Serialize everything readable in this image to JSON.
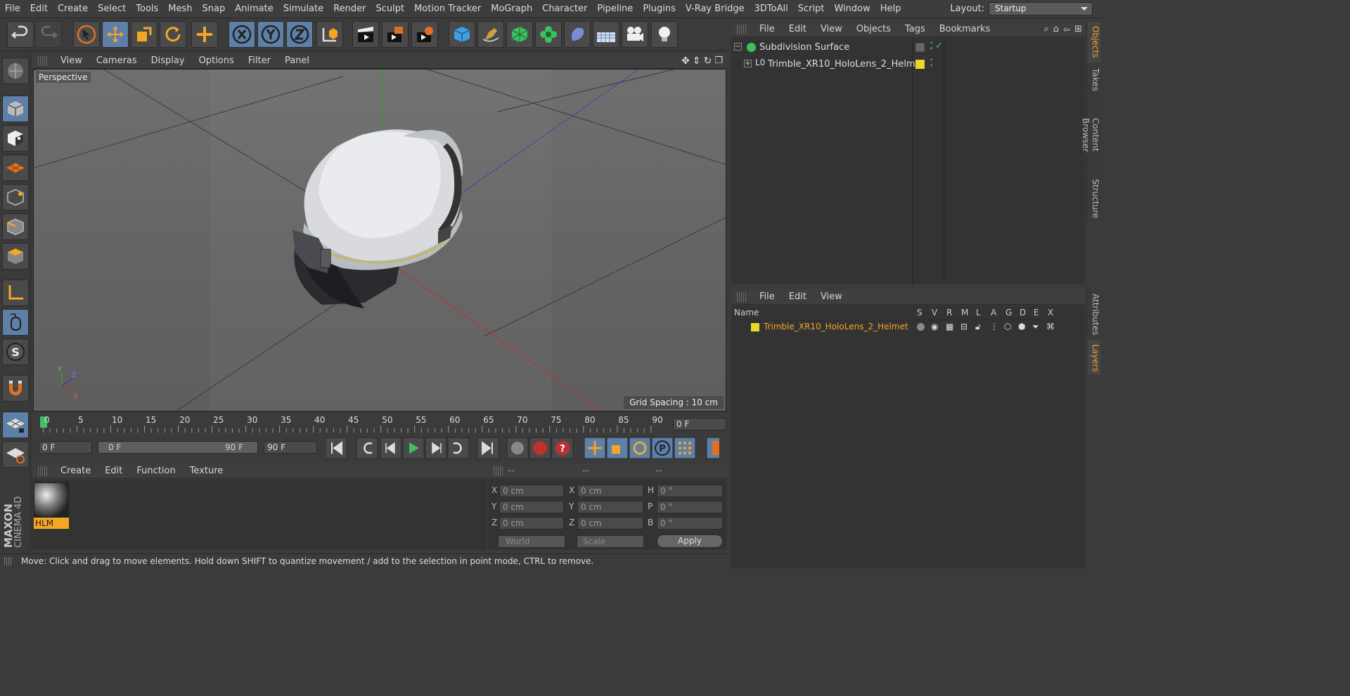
{
  "menubar": {
    "items": [
      "File",
      "Edit",
      "Create",
      "Select",
      "Tools",
      "Mesh",
      "Snap",
      "Animate",
      "Simulate",
      "Render",
      "Sculpt",
      "Motion Tracker",
      "MoGraph",
      "Character",
      "Pipeline",
      "Plugins",
      "V-Ray Bridge",
      "3DToAll",
      "Script",
      "Window",
      "Help"
    ],
    "layout_label": "Layout:",
    "layout_value": "Startup"
  },
  "viewport": {
    "menu": [
      "View",
      "Cameras",
      "Display",
      "Options",
      "Filter",
      "Panel"
    ],
    "camera_label": "Perspective",
    "grid_spacing": "Grid Spacing : 10 cm",
    "axis": {
      "y": "Y",
      "z": "Z",
      "x": "X"
    }
  },
  "timeline": {
    "ticks": [
      "0",
      "5",
      "10",
      "15",
      "20",
      "25",
      "30",
      "35",
      "40",
      "45",
      "50",
      "55",
      "60",
      "65",
      "70",
      "75",
      "80",
      "85",
      "90"
    ],
    "current_frame": "0 F",
    "start_frame": "0 F",
    "range_start": "0 F",
    "range_end": "90 F",
    "end_frame": "90 F"
  },
  "objects_panel": {
    "menu": [
      "File",
      "Edit",
      "View",
      "Objects",
      "Tags",
      "Bookmarks"
    ],
    "items": [
      {
        "name": "Subdivision Surface"
      },
      {
        "name": "Trimble_XR10_HoloLens_2_Helmet"
      }
    ]
  },
  "layers_panel": {
    "menu": [
      "File",
      "Edit",
      "View"
    ],
    "columns": [
      "Name",
      "S",
      "V",
      "R",
      "M",
      "L",
      "A",
      "G",
      "D",
      "E",
      "X"
    ],
    "layer_name": "Trimble_XR10_HoloLens_2_Helmet"
  },
  "material_panel": {
    "menu": [
      "Create",
      "Edit",
      "Function",
      "Texture"
    ],
    "material_name": "HLM"
  },
  "coords_panel": {
    "headers": [
      "--",
      "--",
      "--"
    ],
    "rows": [
      {
        "a": "X",
        "av": "0 cm",
        "b": "X",
        "bv": "0 cm",
        "c": "H",
        "cv": "0 °"
      },
      {
        "a": "Y",
        "av": "0 cm",
        "b": "Y",
        "bv": "0 cm",
        "c": "P",
        "cv": "0 °"
      },
      {
        "a": "Z",
        "av": "0 cm",
        "b": "Z",
        "bv": "0 cm",
        "c": "B",
        "cv": "0 °"
      }
    ],
    "world": "World",
    "scale": "Scale",
    "apply": "Apply"
  },
  "side_tabs": [
    "Objects",
    "Takes",
    "Content Browser",
    "Structure",
    "Attributes",
    "Layers"
  ],
  "status_text": "Move: Click and drag to move elements. Hold down SHIFT to quantize movement / add to the selection in point mode, CTRL to remove.",
  "brand": {
    "line1": "MAXON",
    "line2": "CINEMA 4D"
  }
}
